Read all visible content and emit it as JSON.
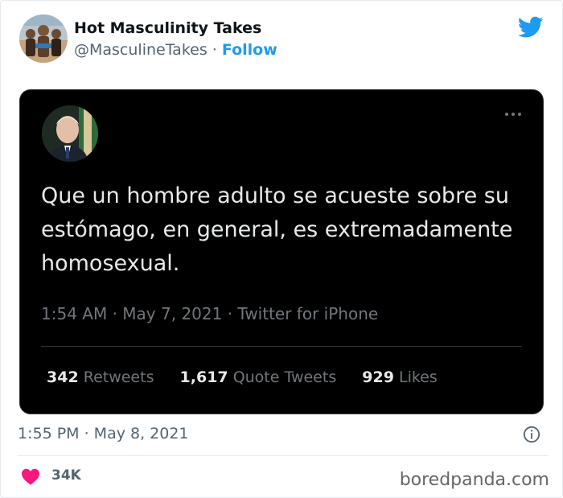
{
  "author": {
    "name": "Hot Masculinity Takes",
    "handle": "@MasculineTakes",
    "separator": "·",
    "follow_label": "Follow"
  },
  "embedded_tweet": {
    "text": "Que un hombre adulto se acueste sobre su estómago, en general, es extremadamente homosexual.",
    "time": "1:54 AM",
    "date": "May 7, 2021",
    "source": "Twitter for iPhone",
    "stats": [
      {
        "count": "342",
        "label": "Retweets"
      },
      {
        "count": "1,617",
        "label": "Quote Tweets"
      },
      {
        "count": "929",
        "label": "Likes"
      }
    ]
  },
  "tweet_meta": {
    "timestamp": "1:55 PM · May 8, 2021"
  },
  "engagement": {
    "likes": "34K"
  },
  "watermark": "boredpanda.com",
  "colors": {
    "twitter_blue": "#1d9bf0",
    "heart_red": "#f91880",
    "embed_bg": "#000000"
  },
  "icons": {
    "brand": "twitter-bird-icon",
    "more": "more-dots-icon",
    "info": "info-icon",
    "like": "heart-icon"
  }
}
